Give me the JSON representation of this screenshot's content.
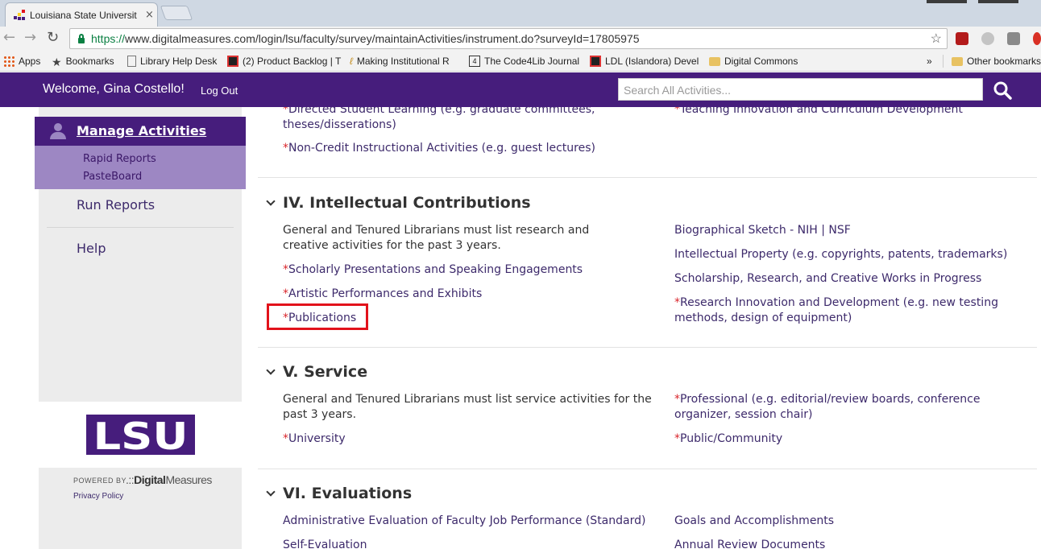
{
  "browser": {
    "tab_title": "Louisiana State Universit",
    "tab_close": "×",
    "url_https": "https://",
    "url_rest": "www.digitalmeasures.com/login/lsu/faculty/survey/maintainActivities/instrument.do?surveyId=17805975",
    "nav": {
      "back": "←",
      "forward": "→",
      "reload": "↻"
    },
    "star": "☆",
    "bookmarks": [
      {
        "label": "Apps"
      },
      {
        "label": "Bookmarks"
      },
      {
        "label": "Library Help Desk"
      },
      {
        "label": "(2) Product Backlog | T"
      },
      {
        "label": "Making Institutional R"
      },
      {
        "label": "The Code4Lib Journal"
      },
      {
        "label": "LDL (Islandora) Devel"
      },
      {
        "label": "Digital Commons"
      },
      {
        "label": "»"
      },
      {
        "label": "Other bookmarks"
      }
    ]
  },
  "header": {
    "welcome": "Welcome, Gina Costello!",
    "logout": "Log Out",
    "search_placeholder": "Search All Activities..."
  },
  "sidebar": {
    "manage": "Manage Activities",
    "sub_items": [
      "Rapid Reports",
      "PasteBoard"
    ],
    "run_reports": "Run Reports",
    "help": "Help",
    "logo_text": "LSU",
    "powered_by": "POWERED BY",
    "dm_prefix": ".::",
    "dm_bold": "Digital",
    "dm_rest": "Measures",
    "privacy": "Privacy Policy"
  },
  "main": {
    "top": {
      "directed_line1": "Directed Student Learning (e.g. graduate committees,",
      "directed_line2": "theses/disserations)",
      "teaching": "Teaching Innovation and Curriculum Development",
      "noncredit": "Non-Credit Instructional Activities (e.g. guest lectures)"
    },
    "required_mark": "*",
    "section4": {
      "title": "IV. Intellectual Contributions",
      "note": "General and Tenured Librarians must list research and creative activities for the past 3 years.",
      "left": [
        "Scholarly Presentations and Speaking Engagements",
        "Artistic Performances and Exhibits",
        "Publications"
      ],
      "right": [
        "Biographical Sketch - NIH | NSF",
        "Intellectual Property (e.g. copyrights, patents, trademarks)",
        "Scholarship, Research, and Creative Works in Progress",
        "Research Innovation and Development (e.g. new testing methods, design of equipment)"
      ]
    },
    "section5": {
      "title": "V. Service",
      "note": "General and Tenured Librarians must list service activities for the past 3 years.",
      "left": [
        "University"
      ],
      "right": [
        "Professional (e.g. editorial/review boards, conference organizer, session chair)",
        "Public/Community"
      ]
    },
    "section6": {
      "title": "VI. Evaluations",
      "left": [
        "Administrative Evaluation of Faculty Job Performance (Standard)",
        "Self-Evaluation"
      ],
      "right": [
        "Goals and Accomplishments",
        "Annual Review Documents"
      ]
    }
  },
  "colors": {
    "brand_purple": "#461d7c",
    "submenu_purple": "#9d87c3",
    "required_red": "#d9262c",
    "highlight_red": "#e2121b"
  }
}
